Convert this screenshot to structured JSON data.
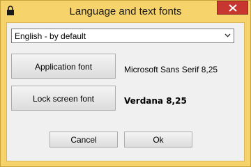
{
  "window": {
    "title": "Language and text fonts",
    "title_icon": "lock-icon",
    "close_icon": "close-icon"
  },
  "language": {
    "selected": "English - by default"
  },
  "fonts": {
    "application_button": "Application font",
    "application_value": "Microsoft Sans Serif 8,25",
    "lock_screen_button": "Lock screen font",
    "lock_screen_value": "Verdana 8,25"
  },
  "actions": {
    "cancel_label": "Cancel",
    "ok_label": "Ok"
  },
  "colors": {
    "frame": "#f6d36b",
    "client_background": "#f0f0f0",
    "close_button": "#c7372f"
  }
}
